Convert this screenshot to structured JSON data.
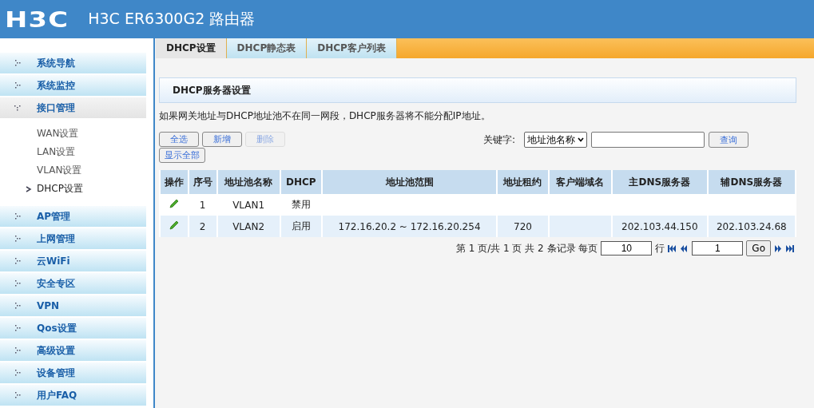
{
  "header": {
    "logo": "H3C",
    "title": "H3C ER6300G2 路由器"
  },
  "sidebar": {
    "items": [
      {
        "label": "系统导航",
        "expanded": false
      },
      {
        "label": "系统监控",
        "expanded": false
      },
      {
        "label": "接口管理",
        "expanded": true,
        "children": [
          {
            "label": "WAN设置",
            "selected": false
          },
          {
            "label": "LAN设置",
            "selected": false
          },
          {
            "label": "VLAN设置",
            "selected": false
          },
          {
            "label": "DHCP设置",
            "selected": true
          }
        ]
      },
      {
        "label": "AP管理",
        "expanded": false
      },
      {
        "label": "上网管理",
        "expanded": false
      },
      {
        "label": "云WiFi",
        "expanded": false
      },
      {
        "label": "安全专区",
        "expanded": false
      },
      {
        "label": "VPN",
        "expanded": false
      },
      {
        "label": "Qos设置",
        "expanded": false
      },
      {
        "label": "高级设置",
        "expanded": false
      },
      {
        "label": "设备管理",
        "expanded": false
      },
      {
        "label": "用户FAQ",
        "expanded": false
      }
    ]
  },
  "tabs": [
    {
      "label": "DHCP设置",
      "selected": true
    },
    {
      "label": "DHCP静态表",
      "selected": false
    },
    {
      "label": "DHCP客户列表",
      "selected": false
    }
  ],
  "section_title": "DHCP服务器设置",
  "notice": "如果网关地址与DHCP地址池不在同一网段，DHCP服务器将不能分配IP地址。",
  "buttons": [
    {
      "label": "全选",
      "disabled": false
    },
    {
      "label": "新增",
      "disabled": false
    },
    {
      "label": "删除",
      "disabled": true
    },
    {
      "label": "显示全部",
      "disabled": false
    }
  ],
  "search": {
    "label": "关键字:",
    "field": "地址池名称",
    "button": "查询"
  },
  "table": {
    "columns": [
      "操作",
      "序号",
      "地址池名称",
      "DHCP",
      "地址池范围",
      "地址租约",
      "客户端域名",
      "主DNS服务器",
      "辅DNS服务器"
    ],
    "rows": [
      {
        "index": "1",
        "name": "VLAN1",
        "dhcp": "禁用",
        "range": "",
        "lease": "",
        "domain": "",
        "dns1": "",
        "dns2": ""
      },
      {
        "index": "2",
        "name": "VLAN2",
        "dhcp": "启用",
        "range": "172.16.20.2 ~ 172.16.20.254",
        "lease": "720",
        "domain": "",
        "dns1": "202.103.44.150",
        "dns2": "202.103.24.68"
      }
    ]
  },
  "pagination": {
    "summary": "第 1 页/共 1 页 共 2 条记录 每页",
    "per_page": "10",
    "rows_label": "行",
    "page": "1",
    "go": "Go"
  }
}
